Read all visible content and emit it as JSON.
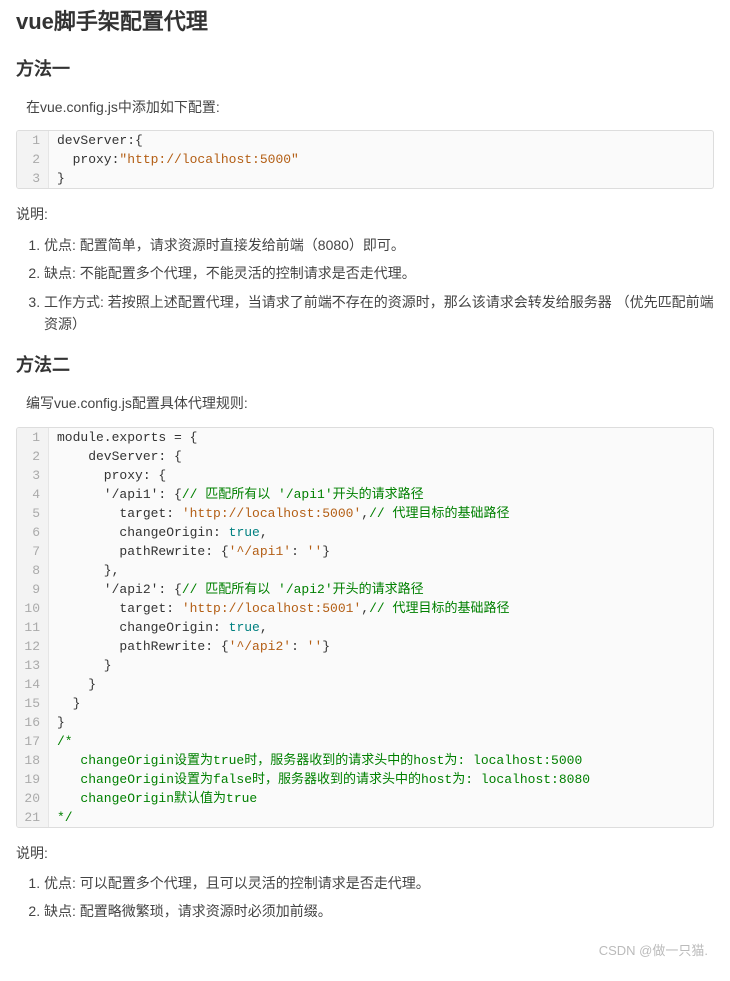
{
  "title": "vue脚手架配置代理",
  "method1": {
    "heading": "方法一",
    "intro": "在vue.config.js中添加如下配置:",
    "code": [
      [
        {
          "t": "devServer:{",
          "c": "plain"
        }
      ],
      [
        {
          "t": "  proxy:",
          "c": "plain"
        },
        {
          "t": "\"http://localhost:5000\"",
          "c": "str"
        }
      ],
      [
        {
          "t": "}",
          "c": "plain"
        }
      ]
    ],
    "desc": "说明:",
    "points": [
      "优点:  配置简单，请求资源时直接发给前端（8080）即可。",
      "缺点:  不能配置多个代理，不能灵活的控制请求是否走代理。",
      "工作方式:  若按照上述配置代理，当请求了前端不存在的资源时，那么该请求会转发给服务器 （优先匹配前端资源）"
    ]
  },
  "method2": {
    "heading": "方法二",
    "intro": "编写vue.config.js配置具体代理规则:",
    "code": [
      [
        {
          "t": "module.exports = {",
          "c": "plain"
        }
      ],
      [
        {
          "t": "    devServer: {",
          "c": "plain"
        }
      ],
      [
        {
          "t": "      proxy: {",
          "c": "plain"
        }
      ],
      [
        {
          "t": "      '/api1': {",
          "c": "plain"
        },
        {
          "t": "// 匹配所有以 '/api1'开头的请求路径",
          "c": "cmt"
        }
      ],
      [
        {
          "t": "        target: ",
          "c": "plain"
        },
        {
          "t": "'http://localhost:5000'",
          "c": "str"
        },
        {
          "t": ",",
          "c": "plain"
        },
        {
          "t": "// 代理目标的基础路径",
          "c": "cmt"
        }
      ],
      [
        {
          "t": "        changeOrigin: ",
          "c": "plain"
        },
        {
          "t": "true",
          "c": "kw"
        },
        {
          "t": ",",
          "c": "plain"
        }
      ],
      [
        {
          "t": "        pathRewrite: {",
          "c": "plain"
        },
        {
          "t": "'^/api1'",
          "c": "str"
        },
        {
          "t": ": ",
          "c": "plain"
        },
        {
          "t": "''",
          "c": "str"
        },
        {
          "t": "}",
          "c": "plain"
        }
      ],
      [
        {
          "t": "      },",
          "c": "plain"
        }
      ],
      [
        {
          "t": "      '/api2': {",
          "c": "plain"
        },
        {
          "t": "// 匹配所有以 '/api2'开头的请求路径",
          "c": "cmt"
        }
      ],
      [
        {
          "t": "        target: ",
          "c": "plain"
        },
        {
          "t": "'http://localhost:5001'",
          "c": "str"
        },
        {
          "t": ",",
          "c": "plain"
        },
        {
          "t": "// 代理目标的基础路径",
          "c": "cmt"
        }
      ],
      [
        {
          "t": "        changeOrigin: ",
          "c": "plain"
        },
        {
          "t": "true",
          "c": "kw"
        },
        {
          "t": ",",
          "c": "plain"
        }
      ],
      [
        {
          "t": "        pathRewrite: {",
          "c": "plain"
        },
        {
          "t": "'^/api2'",
          "c": "str"
        },
        {
          "t": ": ",
          "c": "plain"
        },
        {
          "t": "''",
          "c": "str"
        },
        {
          "t": "}",
          "c": "plain"
        }
      ],
      [
        {
          "t": "      }",
          "c": "plain"
        }
      ],
      [
        {
          "t": "    }",
          "c": "plain"
        }
      ],
      [
        {
          "t": "  }",
          "c": "plain"
        }
      ],
      [
        {
          "t": "}",
          "c": "plain"
        }
      ],
      [
        {
          "t": "/*",
          "c": "cmt"
        }
      ],
      [
        {
          "t": "   changeOrigin设置为true时，服务器收到的请求头中的host为: localhost:5000",
          "c": "cmt"
        }
      ],
      [
        {
          "t": "   changeOrigin设置为false时，服务器收到的请求头中的host为: localhost:8080",
          "c": "cmt"
        }
      ],
      [
        {
          "t": "   changeOrigin默认值为true",
          "c": "cmt"
        }
      ],
      [
        {
          "t": "*/",
          "c": "cmt"
        }
      ]
    ],
    "desc": "说明:",
    "points": [
      "优点:  可以配置多个代理，且可以灵活的控制请求是否走代理。",
      "缺点:  配置略微繁琐，请求资源时必须加前缀。"
    ]
  },
  "watermark": "CSDN @做一只猫."
}
